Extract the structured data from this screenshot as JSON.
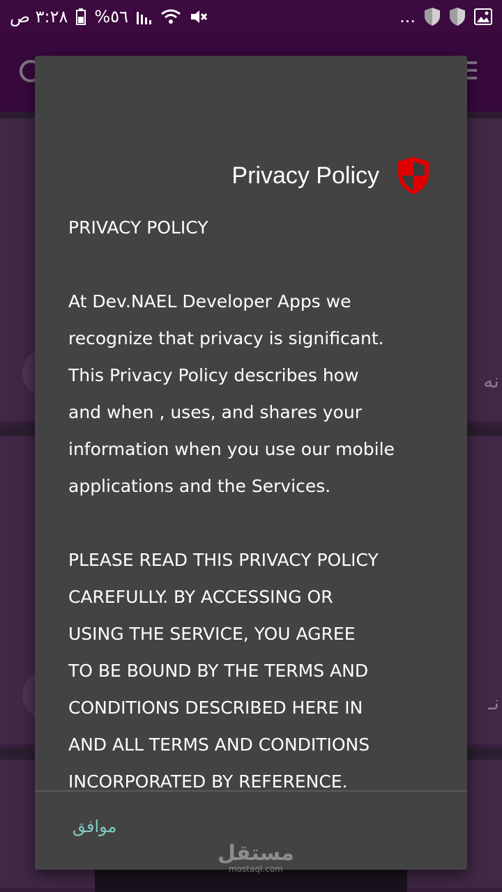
{
  "status_bar": {
    "time": "٣:٢٨ ص",
    "battery": "%٥٦",
    "overflow": "..."
  },
  "dialog": {
    "title": "Privacy Policy",
    "icon": "shield-icon",
    "icon_color": "#e00000",
    "body": {
      "heading": "PRIVACY POLICY",
      "paragraph1": "At Dev.NAEL Developer  Apps we\nrecognize that privacy is significant.\nThis Privacy Policy describes how\nand when , uses, and shares your\ninformation when you use our mobile\napplications and the Services.",
      "paragraph2": "PLEASE READ THIS PRIVACY POLICY\nCAREFULLY. BY ACCESSING OR\nUSING THE SERVICE, YOU AGREE\nTO BE BOUND BY THE TERMS AND\nCONDITIONS DESCRIBED HERE IN\nAND ALL TERMS AND CONDITIONS\nINCORPORATED BY REFERENCE."
    },
    "ok_label": "موافق",
    "accent_color": "#80cbc4"
  },
  "background": {
    "card1_edge_text": "نه",
    "card2_edge_text": "نـ"
  },
  "watermark": {
    "arabic": "مستقل",
    "latin": "mostaql.com"
  }
}
